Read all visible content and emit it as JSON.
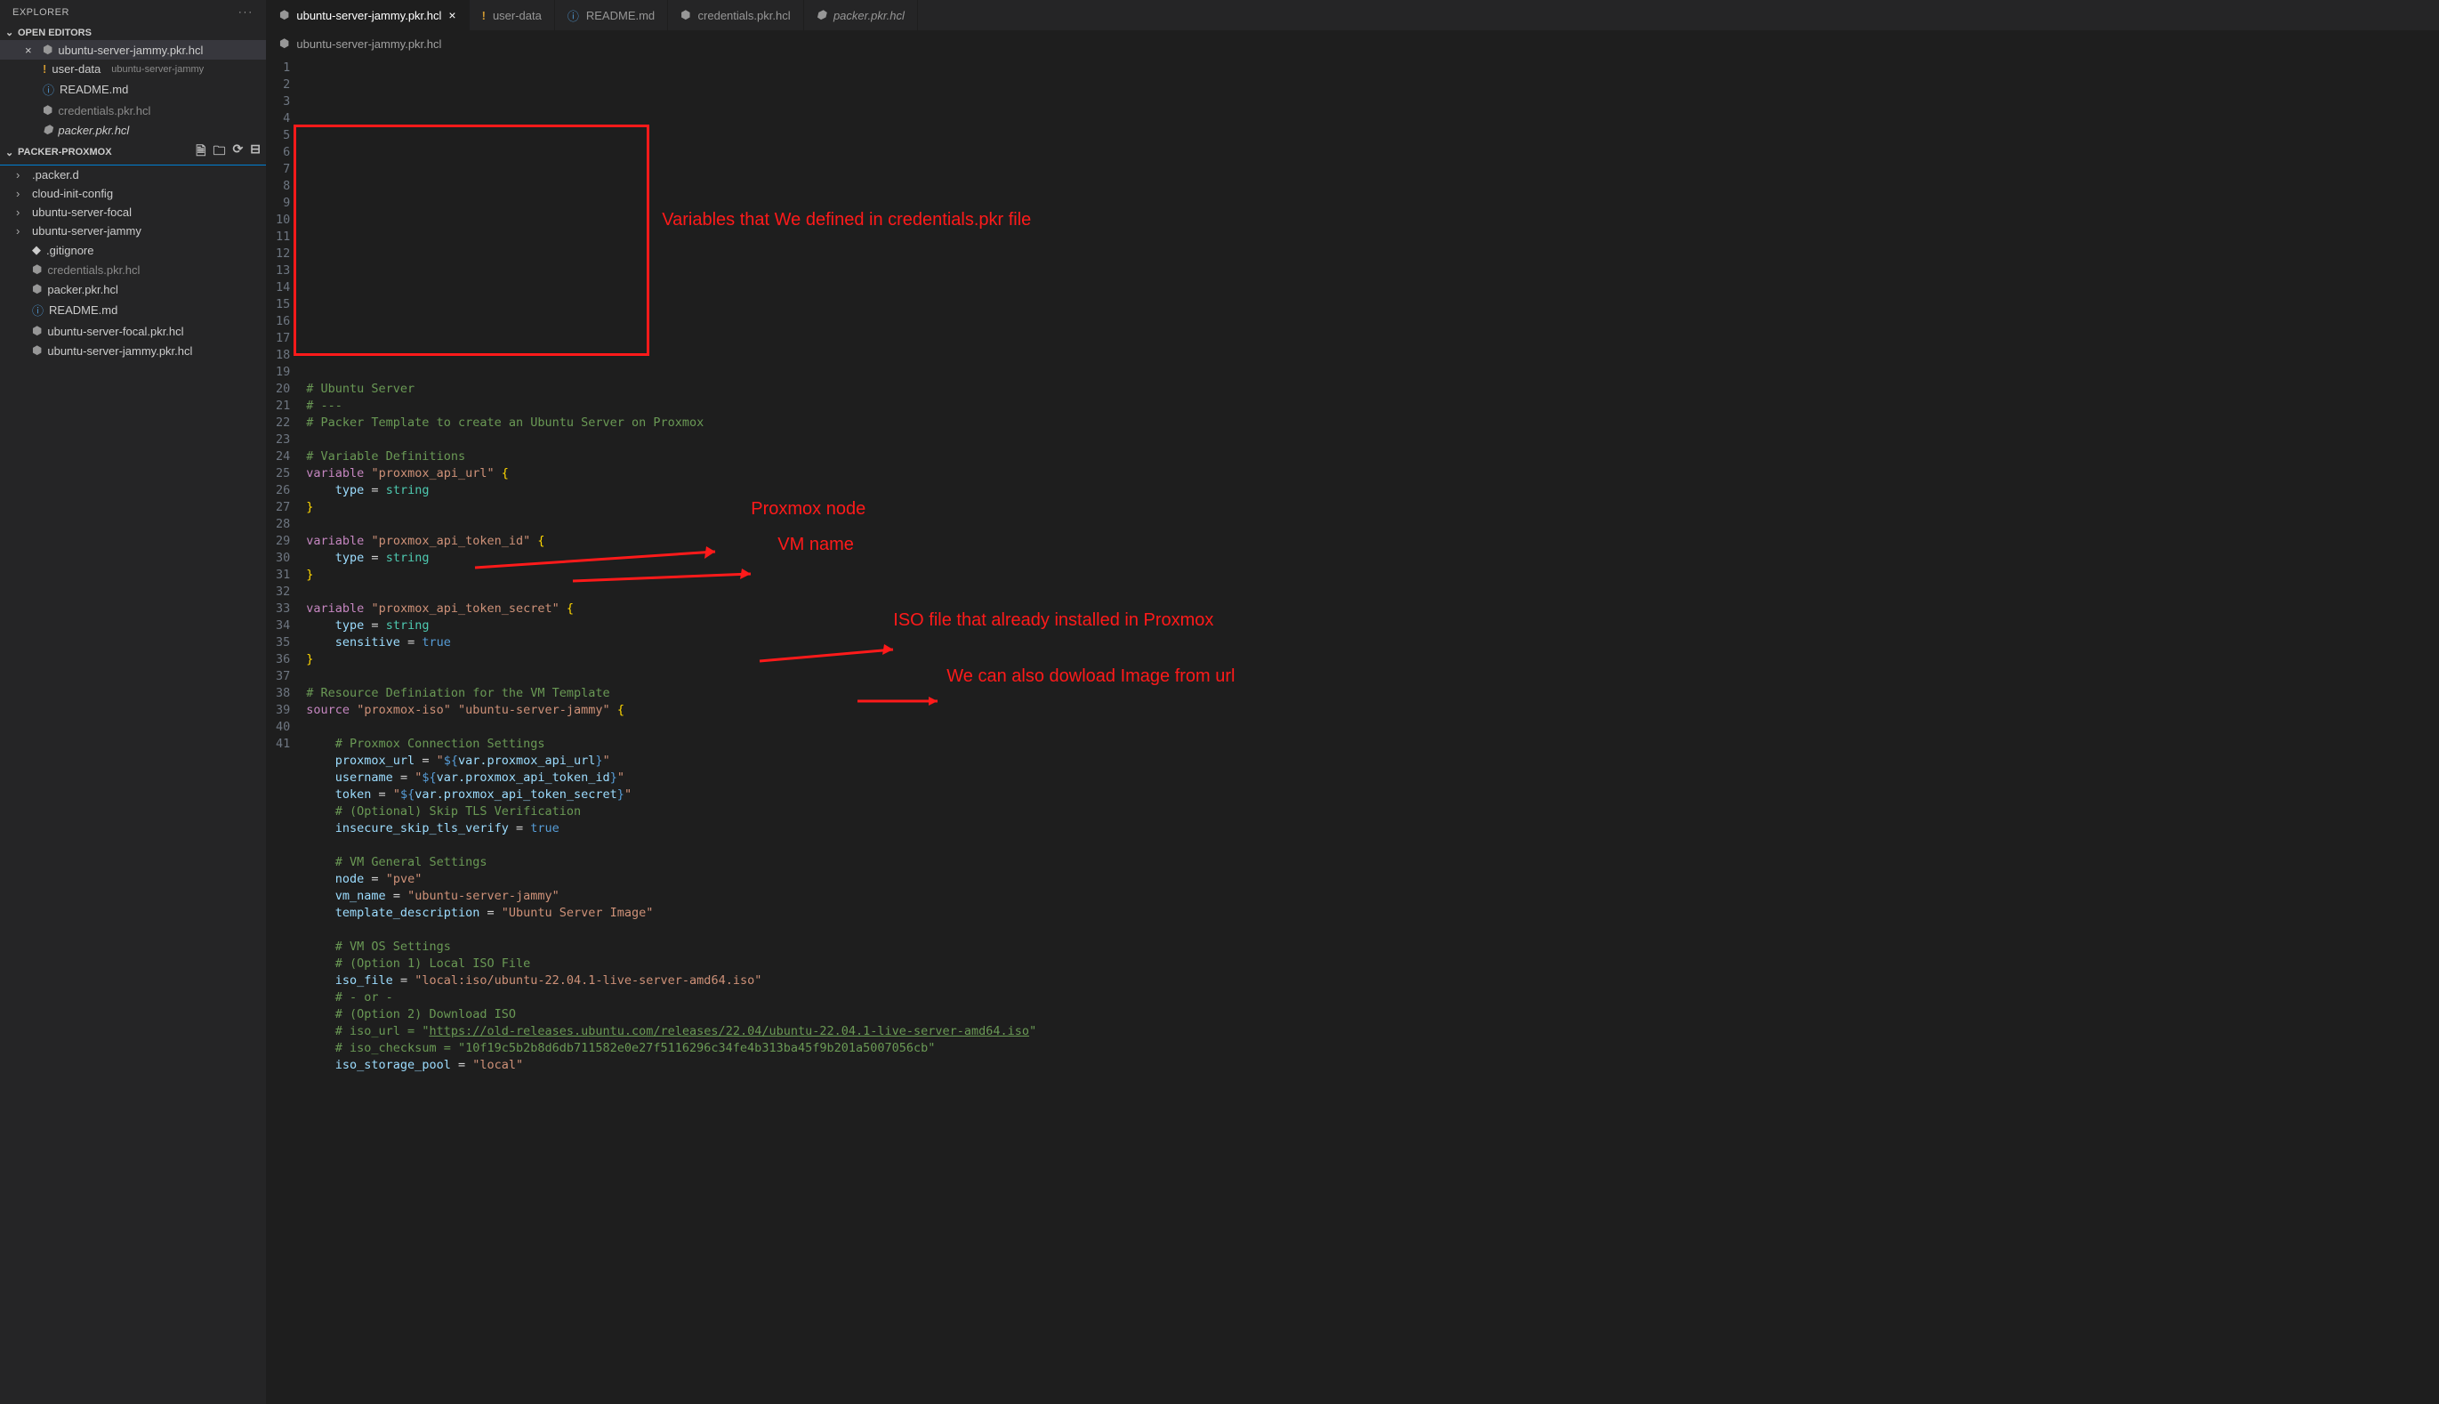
{
  "explorer": {
    "title": "EXPLORER",
    "open_editors_label": "OPEN EDITORS",
    "workspace_label": "PACKER-PROXMOX",
    "editors": [
      {
        "dirty": "×",
        "iconClass": "icon-hcl",
        "name": "ubuntu-server-jammy.pkr.hcl",
        "active": true
      },
      {
        "dirty": "",
        "iconClass": "icon-bang",
        "name": "user-data",
        "hint": "ubuntu-server-jammy"
      },
      {
        "dirty": "",
        "iconClass": "icon-info",
        "name": "README.md"
      },
      {
        "dirty": "",
        "iconClass": "icon-hcl",
        "name": "credentials.pkr.hcl",
        "dim": true
      },
      {
        "dirty": "",
        "iconClass": "icon-hcl",
        "name": "packer.pkr.hcl",
        "italic": true
      }
    ],
    "tree": [
      {
        "type": "folder",
        "name": ".packer.d"
      },
      {
        "type": "folder",
        "name": "cloud-init-config"
      },
      {
        "type": "folder",
        "name": "ubuntu-server-focal"
      },
      {
        "type": "folder",
        "name": "ubuntu-server-jammy"
      },
      {
        "type": "file",
        "iconClass": "",
        "name": ".gitignore"
      },
      {
        "type": "file",
        "iconClass": "icon-hcl",
        "name": "credentials.pkr.hcl",
        "dim": true
      },
      {
        "type": "file",
        "iconClass": "icon-hcl",
        "name": "packer.pkr.hcl"
      },
      {
        "type": "file",
        "iconClass": "icon-info",
        "name": "README.md"
      },
      {
        "type": "file",
        "iconClass": "icon-hcl",
        "name": "ubuntu-server-focal.pkr.hcl"
      },
      {
        "type": "file",
        "iconClass": "icon-hcl",
        "name": "ubuntu-server-jammy.pkr.hcl"
      }
    ]
  },
  "tabs": [
    {
      "iconClass": "icon-hcl",
      "name": "ubuntu-server-jammy.pkr.hcl",
      "active": true,
      "close": true
    },
    {
      "iconClass": "icon-bang",
      "name": "user-data"
    },
    {
      "iconClass": "icon-info",
      "name": "README.md"
    },
    {
      "iconClass": "icon-hcl",
      "name": "credentials.pkr.hcl"
    },
    {
      "iconClass": "icon-hcl",
      "name": "packer.pkr.hcl",
      "italic": true
    }
  ],
  "breadcrumb": "ubuntu-server-jammy.pkr.hcl",
  "annotations": {
    "variables": "Variables that We defined in credentials.pkr file",
    "node": "Proxmox node",
    "vmname": "VM name",
    "iso": "ISO file that already installed in Proxmox",
    "url": "We can also dowload Image from url"
  },
  "code": {
    "lines": [
      {
        "n": 1,
        "segs": [
          {
            "c": "cm",
            "t": "# Ubuntu Server"
          }
        ]
      },
      {
        "n": 2,
        "segs": [
          {
            "c": "cm",
            "t": "# ---"
          }
        ]
      },
      {
        "n": 3,
        "segs": [
          {
            "c": "cm",
            "t": "# Packer Template to create an Ubuntu Server on Proxmox"
          }
        ]
      },
      {
        "n": 4,
        "segs": []
      },
      {
        "n": 5,
        "segs": [
          {
            "c": "cm",
            "t": "# Variable Definitions"
          }
        ]
      },
      {
        "n": 6,
        "segs": [
          {
            "c": "kw",
            "t": "variable"
          },
          {
            "c": "p",
            "t": " "
          },
          {
            "c": "str",
            "t": "\"proxmox_api_url\""
          },
          {
            "c": "p",
            "t": " "
          },
          {
            "c": "br",
            "t": "{"
          }
        ]
      },
      {
        "n": 7,
        "segs": [
          {
            "c": "p",
            "t": "    "
          },
          {
            "c": "id",
            "t": "type"
          },
          {
            "c": "p",
            "t": " = "
          },
          {
            "c": "ty",
            "t": "string"
          }
        ]
      },
      {
        "n": 8,
        "segs": [
          {
            "c": "br",
            "t": "}"
          }
        ]
      },
      {
        "n": 9,
        "segs": []
      },
      {
        "n": 10,
        "segs": [
          {
            "c": "kw",
            "t": "variable"
          },
          {
            "c": "p",
            "t": " "
          },
          {
            "c": "str",
            "t": "\"proxmox_api_token_id\""
          },
          {
            "c": "p",
            "t": " "
          },
          {
            "c": "br",
            "t": "{"
          }
        ]
      },
      {
        "n": 11,
        "segs": [
          {
            "c": "p",
            "t": "    "
          },
          {
            "c": "id",
            "t": "type"
          },
          {
            "c": "p",
            "t": " = "
          },
          {
            "c": "ty",
            "t": "string"
          }
        ]
      },
      {
        "n": 12,
        "segs": [
          {
            "c": "br",
            "t": "}"
          }
        ]
      },
      {
        "n": 13,
        "segs": []
      },
      {
        "n": 14,
        "segs": [
          {
            "c": "kw",
            "t": "variable"
          },
          {
            "c": "p",
            "t": " "
          },
          {
            "c": "str",
            "t": "\"proxmox_api_token_secret\""
          },
          {
            "c": "p",
            "t": " "
          },
          {
            "c": "br",
            "t": "{"
          }
        ]
      },
      {
        "n": 15,
        "segs": [
          {
            "c": "p",
            "t": "    "
          },
          {
            "c": "id",
            "t": "type"
          },
          {
            "c": "p",
            "t": " = "
          },
          {
            "c": "ty",
            "t": "string"
          }
        ]
      },
      {
        "n": 16,
        "segs": [
          {
            "c": "p",
            "t": "    "
          },
          {
            "c": "id",
            "t": "sensitive"
          },
          {
            "c": "p",
            "t": " = "
          },
          {
            "c": "bn",
            "t": "true"
          }
        ]
      },
      {
        "n": 17,
        "segs": [
          {
            "c": "br",
            "t": "}"
          }
        ]
      },
      {
        "n": 18,
        "segs": []
      },
      {
        "n": 19,
        "segs": [
          {
            "c": "cm",
            "t": "# Resource Definiation for the VM Template"
          }
        ]
      },
      {
        "n": 20,
        "segs": [
          {
            "c": "kw",
            "t": "source"
          },
          {
            "c": "p",
            "t": " "
          },
          {
            "c": "str",
            "t": "\"proxmox-iso\""
          },
          {
            "c": "p",
            "t": " "
          },
          {
            "c": "str",
            "t": "\"ubuntu-server-jammy\""
          },
          {
            "c": "p",
            "t": " "
          },
          {
            "c": "br",
            "t": "{"
          }
        ]
      },
      {
        "n": 21,
        "segs": []
      },
      {
        "n": 22,
        "segs": [
          {
            "c": "p",
            "t": "    "
          },
          {
            "c": "cm",
            "t": "# Proxmox Connection Settings"
          }
        ]
      },
      {
        "n": 23,
        "segs": [
          {
            "c": "p",
            "t": "    "
          },
          {
            "c": "id",
            "t": "proxmox_url"
          },
          {
            "c": "p",
            "t": " = "
          },
          {
            "c": "str",
            "t": "\""
          },
          {
            "c": "inter",
            "t": "${"
          },
          {
            "c": "inner",
            "t": "var.proxmox_api_url"
          },
          {
            "c": "inter",
            "t": "}"
          },
          {
            "c": "str",
            "t": "\""
          }
        ]
      },
      {
        "n": 24,
        "segs": [
          {
            "c": "p",
            "t": "    "
          },
          {
            "c": "id",
            "t": "username"
          },
          {
            "c": "p",
            "t": " = "
          },
          {
            "c": "str",
            "t": "\""
          },
          {
            "c": "inter",
            "t": "${"
          },
          {
            "c": "inner",
            "t": "var.proxmox_api_token_id"
          },
          {
            "c": "inter",
            "t": "}"
          },
          {
            "c": "str",
            "t": "\""
          }
        ]
      },
      {
        "n": 25,
        "segs": [
          {
            "c": "p",
            "t": "    "
          },
          {
            "c": "id",
            "t": "token"
          },
          {
            "c": "p",
            "t": " = "
          },
          {
            "c": "str",
            "t": "\""
          },
          {
            "c": "inter",
            "t": "${"
          },
          {
            "c": "inner",
            "t": "var.proxmox_api_token_secret"
          },
          {
            "c": "inter",
            "t": "}"
          },
          {
            "c": "str",
            "t": "\""
          }
        ]
      },
      {
        "n": 26,
        "segs": [
          {
            "c": "p",
            "t": "    "
          },
          {
            "c": "cm",
            "t": "# (Optional) Skip TLS Verification"
          }
        ]
      },
      {
        "n": 27,
        "segs": [
          {
            "c": "p",
            "t": "    "
          },
          {
            "c": "id",
            "t": "insecure_skip_tls_verify"
          },
          {
            "c": "p",
            "t": " = "
          },
          {
            "c": "bn",
            "t": "true"
          }
        ]
      },
      {
        "n": 28,
        "segs": []
      },
      {
        "n": 29,
        "segs": [
          {
            "c": "p",
            "t": "    "
          },
          {
            "c": "cm",
            "t": "# VM General Settings"
          }
        ]
      },
      {
        "n": 30,
        "segs": [
          {
            "c": "p",
            "t": "    "
          },
          {
            "c": "id",
            "t": "node"
          },
          {
            "c": "p",
            "t": " = "
          },
          {
            "c": "str",
            "t": "\"pve\""
          }
        ]
      },
      {
        "n": 31,
        "segs": [
          {
            "c": "p",
            "t": "    "
          },
          {
            "c": "id",
            "t": "vm_name"
          },
          {
            "c": "p",
            "t": " = "
          },
          {
            "c": "str",
            "t": "\"ubuntu-server-jammy\""
          }
        ]
      },
      {
        "n": 32,
        "segs": [
          {
            "c": "p",
            "t": "    "
          },
          {
            "c": "id",
            "t": "template_description"
          },
          {
            "c": "p",
            "t": " = "
          },
          {
            "c": "str",
            "t": "\"Ubuntu Server Image\""
          }
        ]
      },
      {
        "n": 33,
        "segs": []
      },
      {
        "n": 34,
        "segs": [
          {
            "c": "p",
            "t": "    "
          },
          {
            "c": "cm",
            "t": "# VM OS Settings"
          }
        ]
      },
      {
        "n": 35,
        "segs": [
          {
            "c": "p",
            "t": "    "
          },
          {
            "c": "cm",
            "t": "# (Option 1) Local ISO File"
          }
        ]
      },
      {
        "n": 36,
        "segs": [
          {
            "c": "p",
            "t": "    "
          },
          {
            "c": "id",
            "t": "iso_file"
          },
          {
            "c": "p",
            "t": " = "
          },
          {
            "c": "str",
            "t": "\"local:iso/ubuntu-22.04.1-live-server-amd64.iso\""
          }
        ]
      },
      {
        "n": 37,
        "segs": [
          {
            "c": "p",
            "t": "    "
          },
          {
            "c": "cm",
            "t": "# - or -"
          }
        ]
      },
      {
        "n": 38,
        "segs": [
          {
            "c": "p",
            "t": "    "
          },
          {
            "c": "cm",
            "t": "# (Option 2) Download ISO"
          }
        ]
      },
      {
        "n": 39,
        "segs": [
          {
            "c": "p",
            "t": "    "
          },
          {
            "c": "cm",
            "t": "# iso_url = \""
          },
          {
            "c": "cm u",
            "t": "https://old-releases.ubuntu.com/releases/22.04/ubuntu-22.04.1-live-server-amd64.iso"
          },
          {
            "c": "cm",
            "t": "\""
          }
        ]
      },
      {
        "n": 40,
        "segs": [
          {
            "c": "p",
            "t": "    "
          },
          {
            "c": "cm",
            "t": "# iso_checksum = \"10f19c5b2b8d6db711582e0e27f5116296c34fe4b313ba45f9b201a5007056cb\""
          }
        ]
      },
      {
        "n": 41,
        "segs": [
          {
            "c": "p",
            "t": "    "
          },
          {
            "c": "id",
            "t": "iso_storage_pool"
          },
          {
            "c": "p",
            "t": " = "
          },
          {
            "c": "str",
            "t": "\"local\""
          }
        ]
      }
    ]
  }
}
